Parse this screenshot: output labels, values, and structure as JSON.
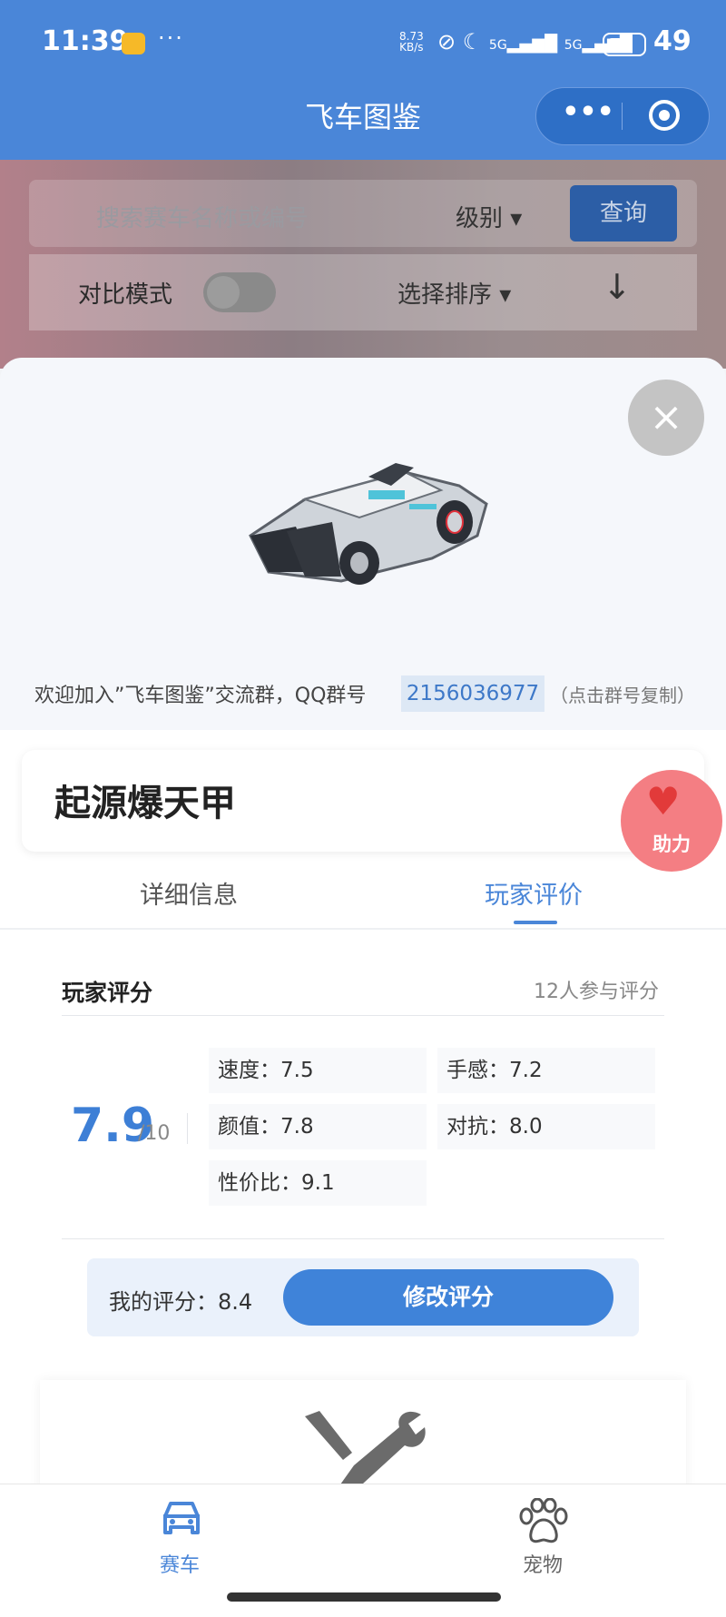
{
  "status_bar": {
    "time": "11:39",
    "dots": "···",
    "net_speed_top": "8.73",
    "net_speed_unit": "KB/s",
    "icons": "⊘ ☾",
    "signal_1": "5G",
    "signal_2": "5G",
    "battery": "49"
  },
  "header": {
    "title": "飞车图鉴",
    "more": "•••"
  },
  "background_page": {
    "search_placeholder": "搜索赛车名称或编号",
    "level_filter": "级别 ▾",
    "query_button": "查询",
    "compare_mode": "对比模式",
    "sort_select": "选择排序 ▾",
    "sort_direction": "↓"
  },
  "modal": {
    "close": "×",
    "qq_prefix": "欢迎加入”飞车图鉴”交流群，QQ群号",
    "qq_number": "2156036977",
    "qq_hint": "（点击群号复制）",
    "car_name": "起源爆天甲",
    "help_label": "助力",
    "tabs": [
      {
        "label": "详细信息",
        "active": false
      },
      {
        "label": "玩家评价",
        "active": true
      }
    ],
    "rating": {
      "title": "玩家评分",
      "participants": "12人参与评分",
      "overall": "7.9",
      "max": "/10",
      "items": [
        {
          "label": "速度：7.5"
        },
        {
          "label": "手感：7.2"
        },
        {
          "label": "颜值：7.8"
        },
        {
          "label": "对抗：8.0"
        },
        {
          "label": "性价比：9.1"
        }
      ],
      "my_score": "我的评分：8.4",
      "modify_button": "修改评分"
    }
  },
  "bottom_nav": [
    {
      "label": "赛车",
      "icon": "car-icon",
      "active": true
    },
    {
      "label": "宠物",
      "icon": "paw-icon",
      "active": false
    }
  ],
  "colors": {
    "brand": "#4a86d8",
    "accent_button": "#3f83d9",
    "help": "#f47e83"
  }
}
